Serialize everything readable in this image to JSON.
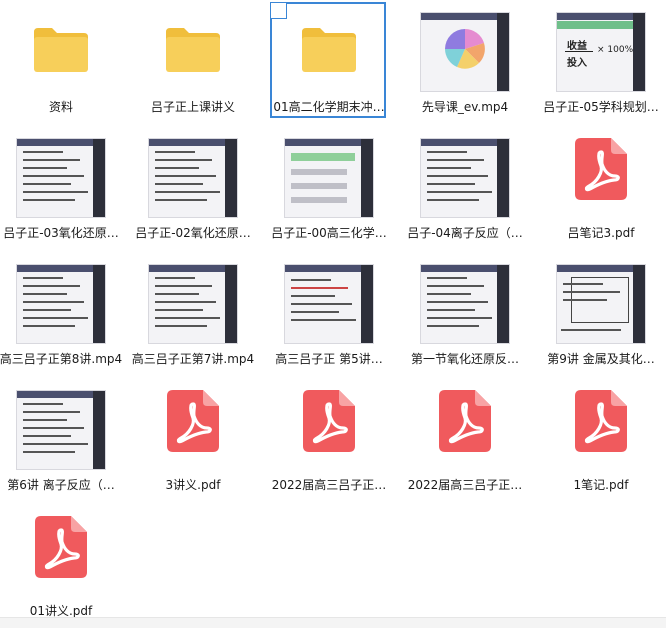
{
  "files": [
    {
      "label": "资料",
      "type": "folder"
    },
    {
      "label": "吕子正上课讲义",
      "type": "folder"
    },
    {
      "label": "01高二化学期末冲…",
      "type": "folder",
      "selected": true
    },
    {
      "label": "先导课_ev.mp4",
      "type": "video-pie"
    },
    {
      "label": "吕子正-05学科规划…",
      "type": "video-formula",
      "formula": {
        "numerator": "收益",
        "denominator": "投入",
        "suffix": "× 100%"
      }
    },
    {
      "label": "吕子正-03氧化还原…",
      "type": "video"
    },
    {
      "label": "吕子正-02氧化还原…",
      "type": "video"
    },
    {
      "label": "吕子正-00高三化学…",
      "type": "video-green"
    },
    {
      "label": "吕子-04离子反应（…",
      "type": "video"
    },
    {
      "label": "吕笔记3.pdf",
      "type": "pdf"
    },
    {
      "label": "高三吕子正第8讲.mp4",
      "type": "video"
    },
    {
      "label": "高三吕子正第7讲.mp4",
      "type": "video"
    },
    {
      "label": "高三吕子正 第5讲…",
      "type": "video-red"
    },
    {
      "label": "第一节氧化还原反…",
      "type": "video"
    },
    {
      "label": "第9讲 金属及其化…",
      "type": "video-table"
    },
    {
      "label": "第6讲 离子反应（…",
      "type": "video"
    },
    {
      "label": "3讲义.pdf",
      "type": "pdf"
    },
    {
      "label": "2022届高三吕子正…",
      "type": "pdf"
    },
    {
      "label": "2022届高三吕子正…",
      "type": "pdf"
    },
    {
      "label": "1笔记.pdf",
      "type": "pdf"
    },
    {
      "label": "01讲义.pdf",
      "type": "pdf"
    }
  ],
  "colors": {
    "folder": "#f7cf5a",
    "folder_back": "#f0be3c",
    "pdf": "#f05a5d",
    "selection": "#3a86d6"
  }
}
